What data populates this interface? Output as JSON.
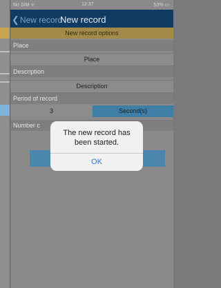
{
  "status_bar": {
    "carrier": "No SIM ᯤ",
    "time": "12:37",
    "battery": "53% ▭"
  },
  "navbar": {
    "back_label": "New record",
    "title": "New record"
  },
  "section_header": "New record options",
  "place": {
    "label": "Place",
    "value": "Place"
  },
  "description": {
    "label": "Description",
    "value": "Description"
  },
  "period": {
    "label": "Period of record",
    "number": "3",
    "unit": "Second(s)"
  },
  "number_label": "Number c",
  "alert": {
    "message": "The new record has been started.",
    "ok_label": "OK"
  },
  "colors": {
    "accent": "#123b63",
    "header_band": "#a38a49",
    "unit_cell": "#3f7fa6",
    "alert_button": "#1c7cd6"
  },
  "left_strip_colors": [
    "#c6a452",
    "#bfbfbf",
    "#bfbfbf",
    "#bfbfbf",
    "#7fb5da"
  ]
}
